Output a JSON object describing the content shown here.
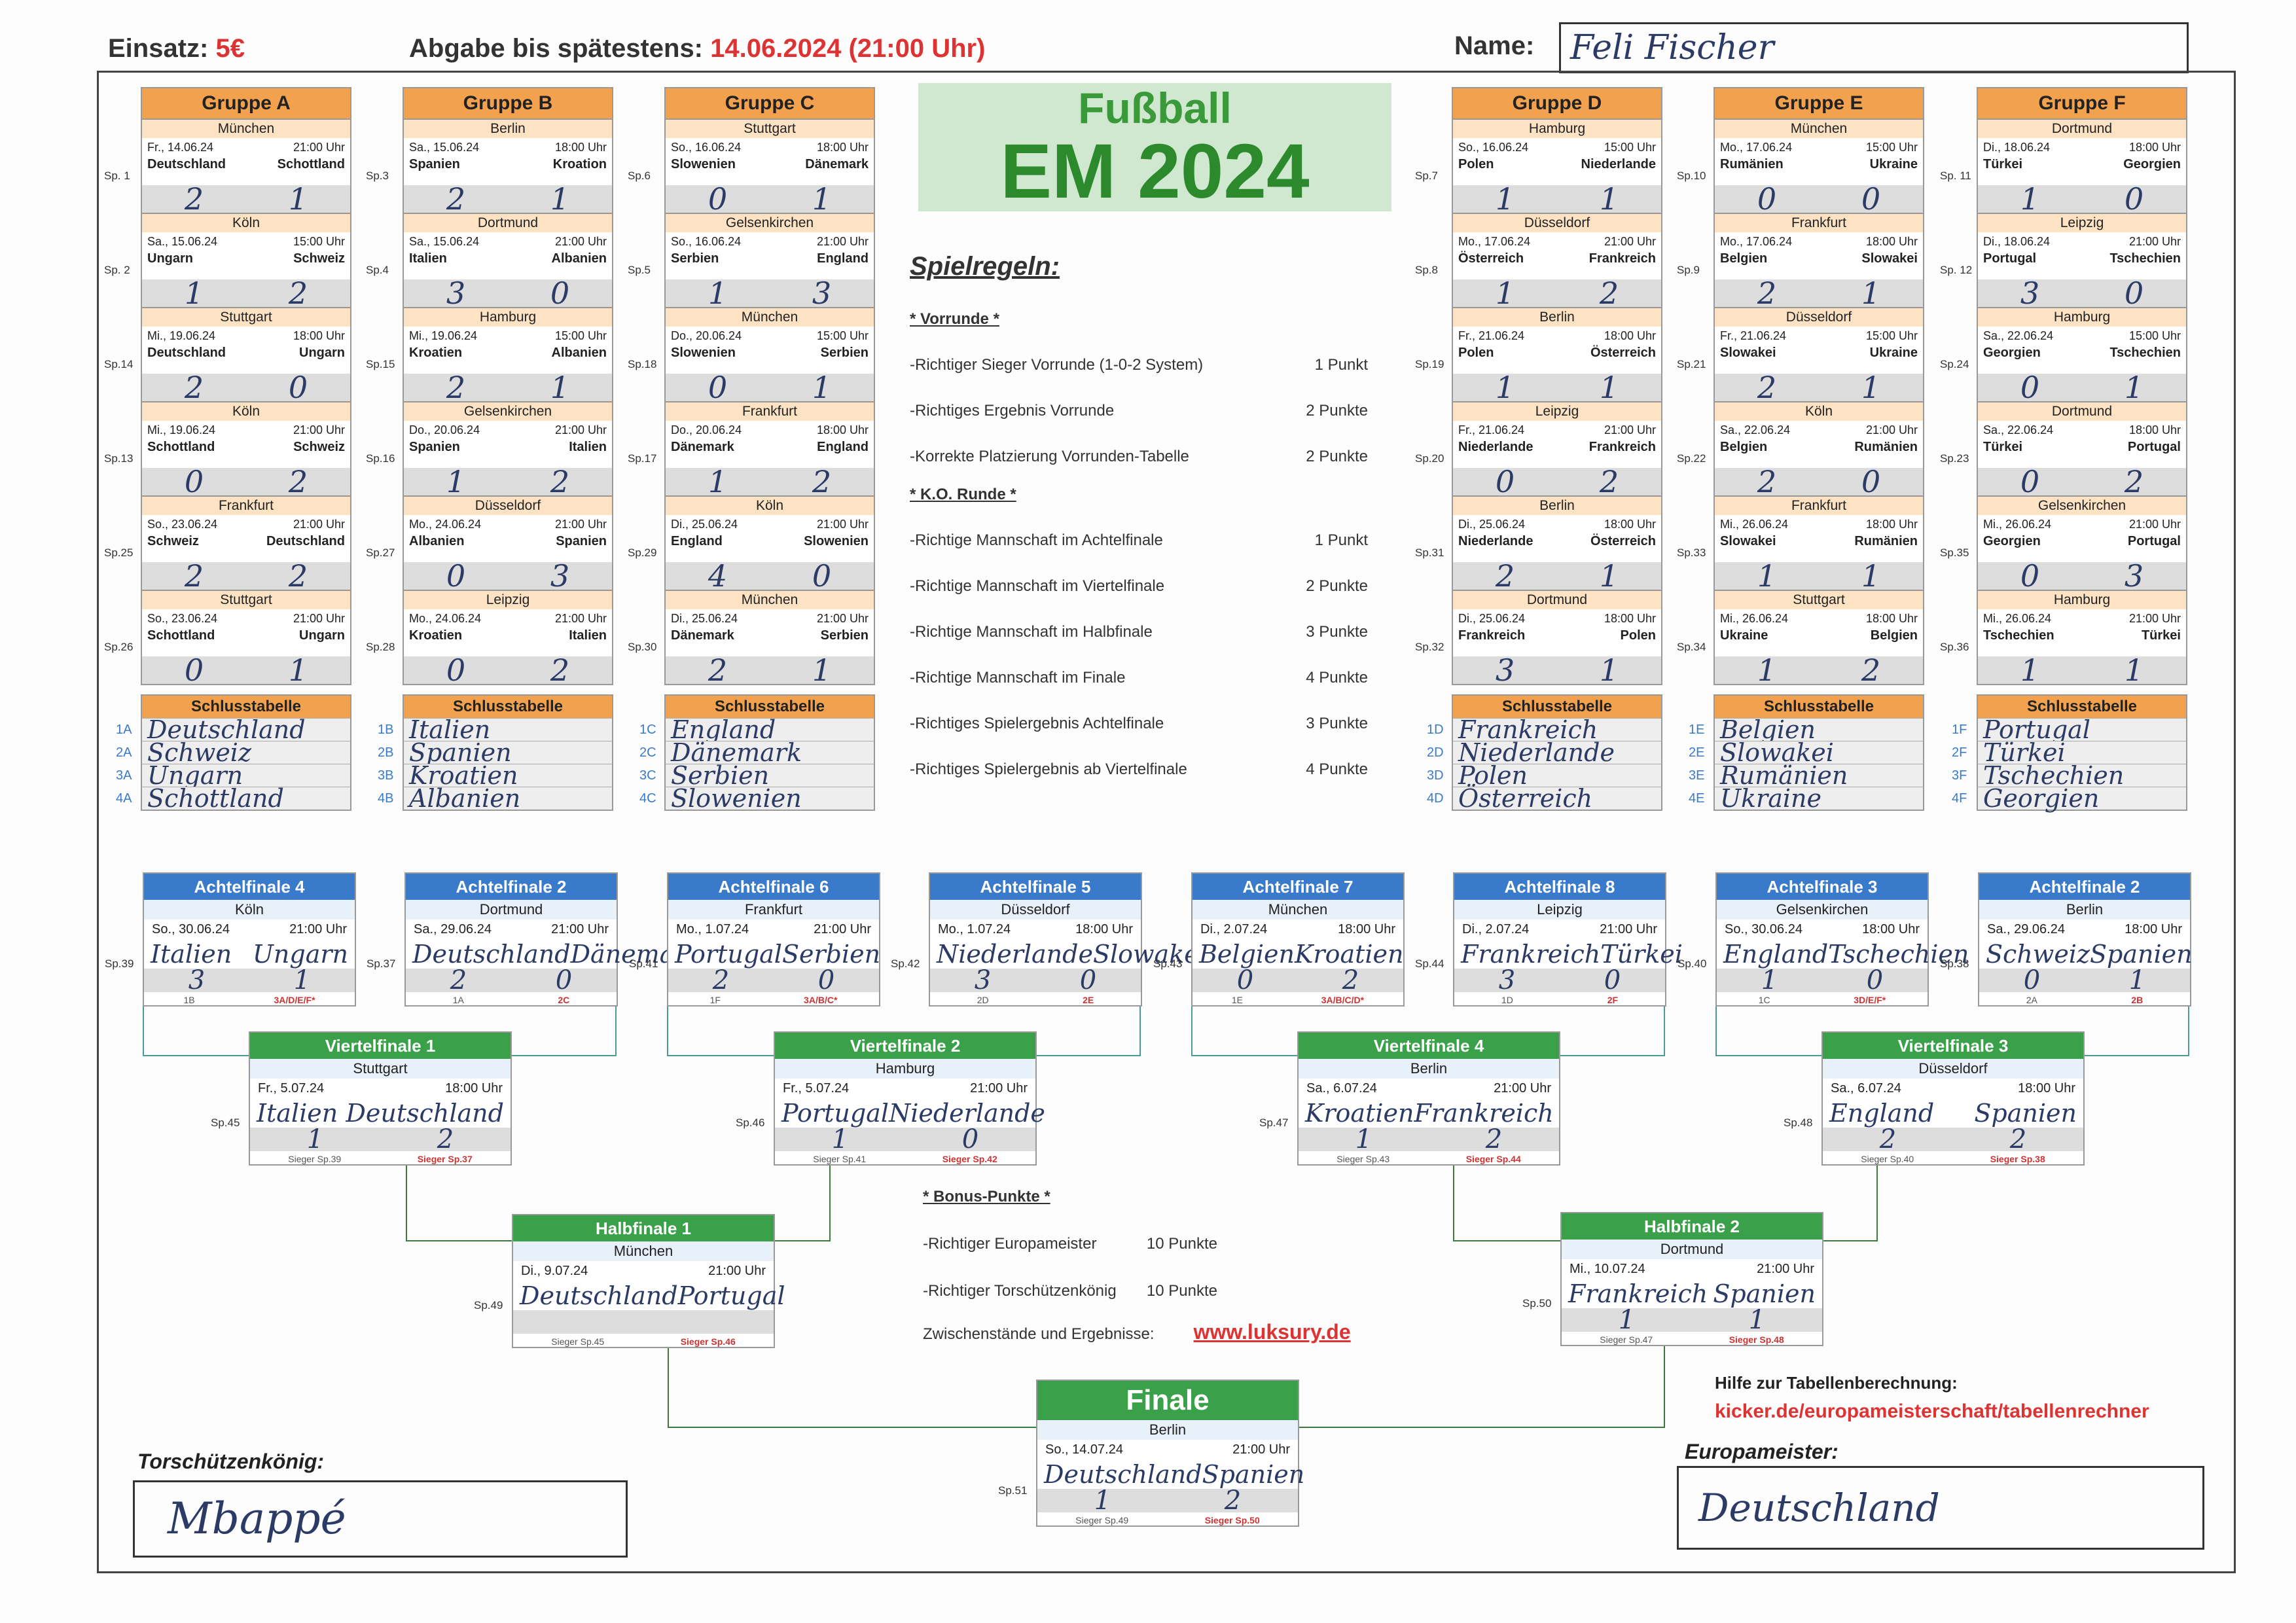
{
  "header": {
    "stake_label": "Einsatz:",
    "stake_value": "5€",
    "deadline_label": "Abgabe bis spätestens:",
    "deadline_value": "14.06.2024 (21:00 Uhr)",
    "name_label": "Name:",
    "name_value": "Feli Fischer"
  },
  "logo": {
    "line1": "Fußball",
    "line2": "EM 2024"
  },
  "groups": [
    {
      "title": "Gruppe A",
      "matches": [
        {
          "sp": "Sp. 1",
          "city": "München",
          "date": "Fr., 14.06.24",
          "time": "21:00 Uhr",
          "home": "Deutschland",
          "away": "Schottland",
          "sh": "2",
          "sa": "1"
        },
        {
          "sp": "Sp. 2",
          "city": "Köln",
          "date": "Sa., 15.06.24",
          "time": "15:00 Uhr",
          "home": "Ungarn",
          "away": "Schweiz",
          "sh": "1",
          "sa": "2"
        },
        {
          "sp": "Sp.14",
          "city": "Stuttgart",
          "date": "Mi., 19.06.24",
          "time": "18:00 Uhr",
          "home": "Deutschland",
          "away": "Ungarn",
          "sh": "2",
          "sa": "0"
        },
        {
          "sp": "Sp.13",
          "city": "Köln",
          "date": "Mi., 19.06.24",
          "time": "21:00 Uhr",
          "home": "Schottland",
          "away": "Schweiz",
          "sh": "0",
          "sa": "2"
        },
        {
          "sp": "Sp.25",
          "city": "Frankfurt",
          "date": "So., 23.06.24",
          "time": "21:00 Uhr",
          "home": "Schweiz",
          "away": "Deutschland",
          "sh": "2",
          "sa": "2"
        },
        {
          "sp": "Sp.26",
          "city": "Stuttgart",
          "date": "So., 23.06.24",
          "time": "21:00 Uhr",
          "home": "Schottland",
          "away": "Ungarn",
          "sh": "0",
          "sa": "1"
        }
      ],
      "table_title": "Schlusstabelle",
      "table": [
        {
          "pos": "1A",
          "team": "Deutschland"
        },
        {
          "pos": "2A",
          "team": "Schweiz"
        },
        {
          "pos": "3A",
          "team": "Ungarn"
        },
        {
          "pos": "4A",
          "team": "Schottland"
        }
      ]
    },
    {
      "title": "Gruppe B",
      "matches": [
        {
          "sp": "Sp.3",
          "city": "Berlin",
          "date": "Sa., 15.06.24",
          "time": "18:00 Uhr",
          "home": "Spanien",
          "away": "Kroation",
          "sh": "2",
          "sa": "1"
        },
        {
          "sp": "Sp.4",
          "city": "Dortmund",
          "date": "Sa., 15.06.24",
          "time": "21:00 Uhr",
          "home": "Italien",
          "away": "Albanien",
          "sh": "3",
          "sa": "0"
        },
        {
          "sp": "Sp.15",
          "city": "Hamburg",
          "date": "Mi., 19.06.24",
          "time": "15:00 Uhr",
          "home": "Kroatien",
          "away": "Albanien",
          "sh": "2",
          "sa": "1"
        },
        {
          "sp": "Sp.16",
          "city": "Gelsenkirchen",
          "date": "Do., 20.06.24",
          "time": "21:00 Uhr",
          "home": "Spanien",
          "away": "Italien",
          "sh": "1",
          "sa": "2"
        },
        {
          "sp": "Sp.27",
          "city": "Düsseldorf",
          "date": "Mo., 24.06.24",
          "time": "21:00 Uhr",
          "home": "Albanien",
          "away": "Spanien",
          "sh": "0",
          "sa": "3"
        },
        {
          "sp": "Sp.28",
          "city": "Leipzig",
          "date": "Mo., 24.06.24",
          "time": "21:00 Uhr",
          "home": "Kroatien",
          "away": "Italien",
          "sh": "0",
          "sa": "2"
        }
      ],
      "table_title": "Schlusstabelle",
      "table": [
        {
          "pos": "1B",
          "team": "Italien"
        },
        {
          "pos": "2B",
          "team": "Spanien"
        },
        {
          "pos": "3B",
          "team": "Kroatien"
        },
        {
          "pos": "4B",
          "team": "Albanien"
        }
      ]
    },
    {
      "title": "Gruppe C",
      "matches": [
        {
          "sp": "Sp.6",
          "city": "Stuttgart",
          "date": "So., 16.06.24",
          "time": "18:00 Uhr",
          "home": "Slowenien",
          "away": "Dänemark",
          "sh": "0",
          "sa": "1"
        },
        {
          "sp": "Sp.5",
          "city": "Gelsenkirchen",
          "date": "So., 16.06.24",
          "time": "21:00 Uhr",
          "home": "Serbien",
          "away": "England",
          "sh": "1",
          "sa": "3"
        },
        {
          "sp": "Sp.18",
          "city": "München",
          "date": "Do., 20.06.24",
          "time": "15:00 Uhr",
          "home": "Slowenien",
          "away": "Serbien",
          "sh": "0",
          "sa": "1"
        },
        {
          "sp": "Sp.17",
          "city": "Frankfurt",
          "date": "Do., 20.06.24",
          "time": "18:00 Uhr",
          "home": "Dänemark",
          "away": "England",
          "sh": "1",
          "sa": "2"
        },
        {
          "sp": "Sp.29",
          "city": "Köln",
          "date": "Di., 25.06.24",
          "time": "21:00 Uhr",
          "home": "England",
          "away": "Slowenien",
          "sh": "4",
          "sa": "0"
        },
        {
          "sp": "Sp.30",
          "city": "München",
          "date": "Di., 25.06.24",
          "time": "21:00 Uhr",
          "home": "Dänemark",
          "away": "Serbien",
          "sh": "2",
          "sa": "1"
        }
      ],
      "table_title": "Schlusstabelle",
      "table": [
        {
          "pos": "1C",
          "team": "England"
        },
        {
          "pos": "2C",
          "team": "Dänemark"
        },
        {
          "pos": "3C",
          "team": "Serbien"
        },
        {
          "pos": "4C",
          "team": "Slowenien"
        }
      ]
    },
    {
      "title": "Gruppe D",
      "matches": [
        {
          "sp": "Sp.7",
          "city": "Hamburg",
          "date": "So., 16.06.24",
          "time": "15:00 Uhr",
          "home": "Polen",
          "away": "Niederlande",
          "sh": "1",
          "sa": "1"
        },
        {
          "sp": "Sp.8",
          "city": "Düsseldorf",
          "date": "Mo., 17.06.24",
          "time": "21:00 Uhr",
          "home": "Österreich",
          "away": "Frankreich",
          "sh": "1",
          "sa": "2"
        },
        {
          "sp": "Sp.19",
          "city": "Berlin",
          "date": "Fr., 21.06.24",
          "time": "18:00 Uhr",
          "home": "Polen",
          "away": "Österreich",
          "sh": "1",
          "sa": "1"
        },
        {
          "sp": "Sp.20",
          "city": "Leipzig",
          "date": "Fr., 21.06.24",
          "time": "21:00 Uhr",
          "home": "Niederlande",
          "away": "Frankreich",
          "sh": "0",
          "sa": "2"
        },
        {
          "sp": "Sp.31",
          "city": "Berlin",
          "date": "Di., 25.06.24",
          "time": "18:00 Uhr",
          "home": "Niederlande",
          "away": "Österreich",
          "sh": "2",
          "sa": "1"
        },
        {
          "sp": "Sp.32",
          "city": "Dortmund",
          "date": "Di., 25.06.24",
          "time": "18:00 Uhr",
          "home": "Frankreich",
          "away": "Polen",
          "sh": "3",
          "sa": "1"
        }
      ],
      "table_title": "Schlusstabelle",
      "table": [
        {
          "pos": "1D",
          "team": "Frankreich"
        },
        {
          "pos": "2D",
          "team": "Niederlande"
        },
        {
          "pos": "3D",
          "team": "Polen"
        },
        {
          "pos": "4D",
          "team": "Österreich"
        }
      ]
    },
    {
      "title": "Gruppe E",
      "matches": [
        {
          "sp": "Sp.10",
          "city": "München",
          "date": "Mo., 17.06.24",
          "time": "15:00 Uhr",
          "home": "Rumänien",
          "away": "Ukraine",
          "sh": "0",
          "sa": "0"
        },
        {
          "sp": "Sp.9",
          "city": "Frankfurt",
          "date": "Mo., 17.06.24",
          "time": "18:00 Uhr",
          "home": "Belgien",
          "away": "Slowakei",
          "sh": "2",
          "sa": "1"
        },
        {
          "sp": "Sp.21",
          "city": "Düsseldorf",
          "date": "Fr., 21.06.24",
          "time": "15:00 Uhr",
          "home": "Slowakei",
          "away": "Ukraine",
          "sh": "2",
          "sa": "1"
        },
        {
          "sp": "Sp.22",
          "city": "Köln",
          "date": "Sa., 22.06.24",
          "time": "21:00 Uhr",
          "home": "Belgien",
          "away": "Rumänien",
          "sh": "2",
          "sa": "0"
        },
        {
          "sp": "Sp.33",
          "city": "Frankfurt",
          "date": "Mi., 26.06.24",
          "time": "18:00 Uhr",
          "home": "Slowakei",
          "away": "Rumänien",
          "sh": "1",
          "sa": "1"
        },
        {
          "sp": "Sp.34",
          "city": "Stuttgart",
          "date": "Mi., 26.06.24",
          "time": "18:00 Uhr",
          "home": "Ukraine",
          "away": "Belgien",
          "sh": "1",
          "sa": "2"
        }
      ],
      "table_title": "Schlusstabelle",
      "table": [
        {
          "pos": "1E",
          "team": "Belgien"
        },
        {
          "pos": "2E",
          "team": "Slowakei"
        },
        {
          "pos": "3E",
          "team": "Rumänien"
        },
        {
          "pos": "4E",
          "team": "Ukraine"
        }
      ]
    },
    {
      "title": "Gruppe F",
      "matches": [
        {
          "sp": "Sp. 11",
          "city": "Dortmund",
          "date": "Di., 18.06.24",
          "time": "18:00 Uhr",
          "home": "Türkei",
          "away": "Georgien",
          "sh": "1",
          "sa": "0"
        },
        {
          "sp": "Sp. 12",
          "city": "Leipzig",
          "date": "Di., 18.06.24",
          "time": "21:00 Uhr",
          "home": "Portugal",
          "away": "Tschechien",
          "sh": "3",
          "sa": "0"
        },
        {
          "sp": "Sp.24",
          "city": "Hamburg",
          "date": "Sa., 22.06.24",
          "time": "15:00 Uhr",
          "home": "Georgien",
          "away": "Tschechien",
          "sh": "0",
          "sa": "1"
        },
        {
          "sp": "Sp.23",
          "city": "Dortmund",
          "date": "Sa., 22.06.24",
          "time": "18:00 Uhr",
          "home": "Türkei",
          "away": "Portugal",
          "sh": "0",
          "sa": "2"
        },
        {
          "sp": "Sp.35",
          "city": "Gelsenkirchen",
          "date": "Mi., 26.06.24",
          "time": "21:00 Uhr",
          "home": "Georgien",
          "away": "Portugal",
          "sh": "0",
          "sa": "3"
        },
        {
          "sp": "Sp.36",
          "city": "Hamburg",
          "date": "Mi., 26.06.24",
          "time": "21:00 Uhr",
          "home": "Tschechien",
          "away": "Türkei",
          "sh": "1",
          "sa": "1"
        }
      ],
      "table_title": "Schlusstabelle",
      "table": [
        {
          "pos": "1F",
          "team": "Portugal"
        },
        {
          "pos": "2F",
          "team": "Türkei"
        },
        {
          "pos": "3F",
          "team": "Tschechien"
        },
        {
          "pos": "4F",
          "team": "Georgien"
        }
      ]
    }
  ],
  "rules": {
    "title": "Spielregeln:",
    "vorrunde_title": "* Vorrunde *",
    "vorrunde": [
      {
        "text": "-Richtiger Sieger Vorrunde (1-0-2 System)",
        "pts": "1 Punkt"
      },
      {
        "text": "-Richtiges Ergebnis Vorrunde",
        "pts": "2 Punkte"
      },
      {
        "text": "-Korrekte Platzierung Vorrunden-Tabelle",
        "pts": "2 Punkte"
      }
    ],
    "ko_title": "* K.O. Runde *",
    "ko": [
      {
        "text": "-Richtige Mannschaft im Achtelfinale",
        "pts": "1 Punkt"
      },
      {
        "text": "-Richtige Mannschaft im Viertelfinale",
        "pts": "2 Punkte"
      },
      {
        "text": "-Richtige Mannschaft im Halbfinale",
        "pts": "3 Punkte"
      },
      {
        "text": "-Richtige Mannschaft im Finale",
        "pts": "4 Punkte"
      },
      {
        "text": "-Richtiges Spielergebnis Achtelfinale",
        "pts": "3 Punkte"
      },
      {
        "text": "-Richtiges Spielergebnis ab Viertelfinale",
        "pts": "4 Punkte"
      }
    ],
    "bonus_title": "* Bonus-Punkte *",
    "bonus": [
      {
        "text": "-Richtiger Europameister",
        "pts": "10 Punkte"
      },
      {
        "text": "-Richtiger Torschützenkönig",
        "pts": "10 Punkte"
      }
    ],
    "interim_label": "Zwischenstände und Ergebnisse:",
    "interim_link": "www.luksury.de"
  },
  "help": {
    "label": "Hilfe zur Tabellenberechnung:",
    "link": "kicker.de/europameisterschaft/tabellenrechner"
  },
  "r16": [
    {
      "title": "Achtelfinale 4",
      "sp": "Sp.39",
      "city": "Köln",
      "date": "So., 30.06.24",
      "time": "21:00 Uhr",
      "home": "Italien",
      "away": "Ungarn",
      "sh": "3",
      "sa": "1",
      "src1": "1B",
      "src2": "3A/D/E/F*"
    },
    {
      "title": "Achtelfinale 2",
      "sp": "Sp.37",
      "city": "Dortmund",
      "date": "Sa., 29.06.24",
      "time": "21:00 Uhr",
      "home": "Deutschland",
      "away": "Dänemark",
      "sh": "2",
      "sa": "0",
      "src1": "1A",
      "src2": "2C"
    },
    {
      "title": "Achtelfinale 6",
      "sp": "Sp.41",
      "city": "Frankfurt",
      "date": "Mo., 1.07.24",
      "time": "21:00 Uhr",
      "home": "Portugal",
      "away": "Serbien",
      "sh": "2",
      "sa": "0",
      "src1": "1F",
      "src2": "3A/B/C*"
    },
    {
      "title": "Achtelfinale 5",
      "sp": "Sp.42",
      "city": "Düsseldorf",
      "date": "Mo., 1.07.24",
      "time": "18:00 Uhr",
      "home": "Niederlande",
      "away": "Slowakei",
      "sh": "3",
      "sa": "0",
      "src1": "2D",
      "src2": "2E"
    },
    {
      "title": "Achtelfinale 7",
      "sp": "Sp.43",
      "city": "München",
      "date": "Di., 2.07.24",
      "time": "18:00 Uhr",
      "home": "Belgien",
      "away": "Kroatien",
      "sh": "0",
      "sa": "2",
      "src1": "1E",
      "src2": "3A/B/C/D*"
    },
    {
      "title": "Achtelfinale 8",
      "sp": "Sp.44",
      "city": "Leipzig",
      "date": "Di., 2.07.24",
      "time": "21:00 Uhr",
      "home": "Frankreich",
      "away": "Türkei",
      "sh": "3",
      "sa": "0",
      "src1": "1D",
      "src2": "2F"
    },
    {
      "title": "Achtelfinale 3",
      "sp": "Sp.40",
      "city": "Gelsenkirchen",
      "date": "So., 30.06.24",
      "time": "18:00 Uhr",
      "home": "England",
      "away": "Tschechien",
      "sh": "1",
      "sa": "0",
      "src1": "1C",
      "src2": "3D/E/F*"
    },
    {
      "title": "Achtelfinale 2",
      "sp": "Sp.38",
      "city": "Berlin",
      "date": "Sa., 29.06.24",
      "time": "18:00 Uhr",
      "home": "Schweiz",
      "away": "Spanien",
      "sh": "0",
      "sa": "1",
      "src1": "2A",
      "src2": "2B"
    }
  ],
  "qf": [
    {
      "title": "Viertelfinale 1",
      "sp": "Sp.45",
      "city": "Stuttgart",
      "date": "Fr., 5.07.24",
      "time": "18:00 Uhr",
      "home": "Italien",
      "away": "Deutschland",
      "sh": "1",
      "sa": "2",
      "src1": "Sieger Sp.39",
      "src2": "Sieger Sp.37"
    },
    {
      "title": "Viertelfinale 2",
      "sp": "Sp.46",
      "city": "Hamburg",
      "date": "Fr., 5.07.24",
      "time": "21:00 Uhr",
      "home": "Portugal",
      "away": "Niederlande",
      "sh": "1",
      "sa": "0",
      "src1": "Sieger Sp.41",
      "src2": "Sieger Sp.42"
    },
    {
      "title": "Viertelfinale 4",
      "sp": "Sp.47",
      "city": "Berlin",
      "date": "Sa., 6.07.24",
      "time": "21:00 Uhr",
      "home": "Kroatien",
      "away": "Frankreich",
      "sh": "1",
      "sa": "2",
      "src1": "Sieger Sp.43",
      "src2": "Sieger Sp.44"
    },
    {
      "title": "Viertelfinale 3",
      "sp": "Sp.48",
      "city": "Düsseldorf",
      "date": "Sa., 6.07.24",
      "time": "18:00 Uhr",
      "home": "England",
      "away": "Spanien",
      "sh": "2",
      "sa": "2",
      "src1": "Sieger Sp.40",
      "src2": "Sieger Sp.38"
    }
  ],
  "sf": [
    {
      "title": "Halbfinale 1",
      "sp": "Sp.49",
      "city": "München",
      "date": "Di., 9.07.24",
      "time": "21:00 Uhr",
      "home": "Deutschland",
      "away": "Portugal",
      "sh": "",
      "sa": "",
      "src1": "Sieger Sp.45",
      "src2": "Sieger Sp.46"
    },
    {
      "title": "Halbfinale 2",
      "sp": "Sp.50",
      "city": "Dortmund",
      "date": "Mi., 10.07.24",
      "time": "21:00 Uhr",
      "home": "Frankreich",
      "away": "Spanien",
      "sh": "1",
      "sa": "1",
      "src1": "Sieger Sp.47",
      "src2": "Sieger Sp.48"
    }
  ],
  "final": {
    "title": "Finale",
    "sp": "Sp.51",
    "city": "Berlin",
    "date": "So., 14.07.24",
    "time": "21:00 Uhr",
    "home": "Deutschland",
    "away": "Spanien",
    "sh": "1",
    "sa": "2",
    "src1": "Sieger Sp.49",
    "src2": "Sieger Sp.50"
  },
  "topscorer": {
    "label": "Torschützenkönig:",
    "value": "Mbappé"
  },
  "champion": {
    "label": "Europameister:",
    "value": "Deutschland"
  },
  "colors": {
    "group": "#f2a24e",
    "r16": "#3a7acb",
    "qf": "#3aa04a",
    "link": "#d33"
  }
}
